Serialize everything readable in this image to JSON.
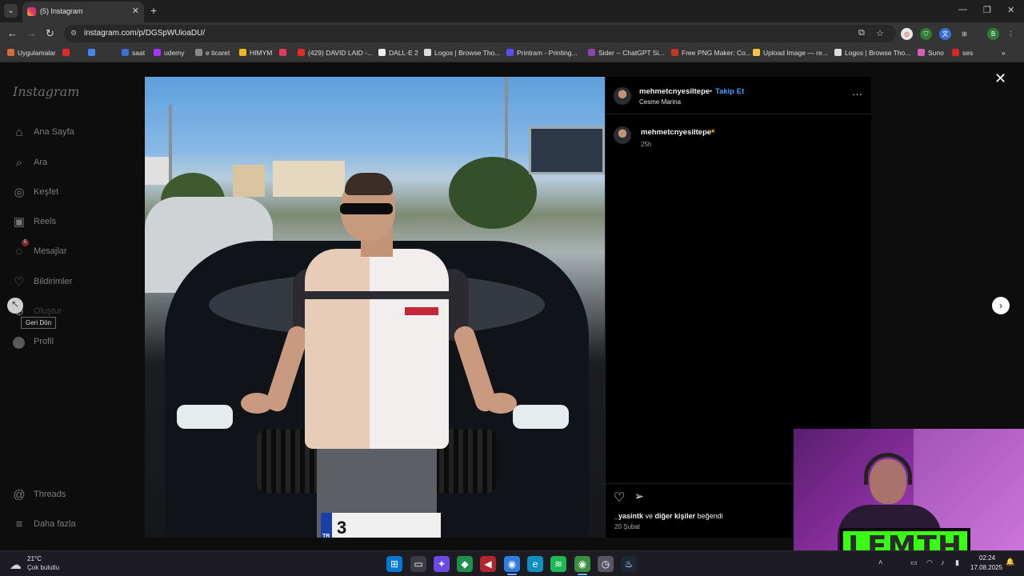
{
  "browser": {
    "tab_title": "(5) Instagram",
    "url": "instagram.com/p/DGSpWUioaDU/",
    "bookmarks": [
      {
        "label": "Uygulamalar",
        "color": "#d66a3a"
      },
      {
        "label": "",
        "color": "#e02b2b"
      },
      {
        "label": "",
        "color": "#4285f4"
      },
      {
        "label": "saat",
        "color": "#3b6fd6"
      },
      {
        "label": "udemy",
        "color": "#a435f0"
      },
      {
        "label": "e ticaret",
        "color": "#888888"
      },
      {
        "label": "HIMYM",
        "color": "#f0b429"
      },
      {
        "label": "",
        "color": "#e8365d"
      },
      {
        "label": "(429) DAVID LAID -...",
        "color": "#e02b2b"
      },
      {
        "label": "DALL·E 2",
        "color": "#eeeeee"
      },
      {
        "label": "Logos | Browse Tho...",
        "color": "#dddddd"
      },
      {
        "label": "Printram - Printing...",
        "color": "#5b4df0"
      },
      {
        "label": "Sider -- ChatGPT Si...",
        "color": "#8e44ad"
      },
      {
        "label": "Free PNG Maker: Co...",
        "color": "#c0392b"
      },
      {
        "label": "Upload Image — re...",
        "color": "#f5c542"
      },
      {
        "label": "Logos | Browse Tho...",
        "color": "#dddddd"
      },
      {
        "label": "Suno",
        "color": "#d65db1"
      },
      {
        "label": "ses",
        "color": "#d62828"
      }
    ]
  },
  "sidebar": {
    "logo": "Instagram",
    "items": [
      {
        "label": "Ana Sayfa",
        "icon": "home-icon",
        "glyph": "⌂"
      },
      {
        "label": "Ara",
        "icon": "search-icon",
        "glyph": "⌕"
      },
      {
        "label": "Keşfet",
        "icon": "compass-icon",
        "glyph": "◎"
      },
      {
        "label": "Reels",
        "icon": "reels-icon",
        "glyph": "▣"
      },
      {
        "label": "Mesajlar",
        "icon": "messenger-icon",
        "glyph": "◌"
      },
      {
        "label": "Bildirimler",
        "icon": "heart-icon",
        "glyph": "♡"
      },
      {
        "label": "Oluştur",
        "icon": "create-icon",
        "glyph": "⊕"
      },
      {
        "label": "Profil",
        "icon": "profile-avatar",
        "glyph": ""
      }
    ],
    "bottom_items": [
      {
        "label": "Threads",
        "icon": "threads-icon",
        "glyph": "@"
      },
      {
        "label": "Daha fazla",
        "icon": "menu-icon",
        "glyph": "≡"
      }
    ],
    "messages_badge": "5",
    "tooltip": "Geri Dön"
  },
  "post": {
    "username": "mehmetcnyesiltepe",
    "follow_label": "Takip Et",
    "separator": "•",
    "location": "Cesme Marina",
    "caption_emoji": "☀",
    "caption_time": "25h",
    "plate_text": "3",
    "plate_country": "TR",
    "likes_user": "_yasintk",
    "likes_conj": " ve ",
    "likes_others": "diğer kişiler",
    "likes_suffix": " beğendi",
    "date": "20 Şubat"
  },
  "webcam": {
    "overlay_text": "LEMTH"
  },
  "taskbar": {
    "temp": "21°C",
    "weather": "Çok bulutlu",
    "time": "02:24",
    "date": "17.08.2025",
    "apps": [
      {
        "name": "windows-start-icon",
        "glyph": "⊞",
        "color": "#0078d4"
      },
      {
        "name": "task-view-icon",
        "glyph": "▭",
        "color": "#3a3a44"
      },
      {
        "name": "copilot-icon",
        "glyph": "✦",
        "color": "#6a4ce0"
      },
      {
        "name": "app-green-icon",
        "glyph": "◆",
        "color": "#1f8f4e"
      },
      {
        "name": "app-red-icon",
        "glyph": "◀",
        "color": "#b3262b"
      },
      {
        "name": "chrome-icon",
        "glyph": "◉",
        "color": "#2f7de1"
      },
      {
        "name": "edge-icon",
        "glyph": "e",
        "color": "#0f8ec0"
      },
      {
        "name": "spotify-icon",
        "glyph": "≋",
        "color": "#1db954"
      },
      {
        "name": "chrome-profile-icon",
        "glyph": "◉",
        "color": "#3a8f3e"
      },
      {
        "name": "app-clock-icon",
        "glyph": "◷",
        "color": "#555566"
      },
      {
        "name": "steam-icon",
        "glyph": "♨",
        "color": "#1b2838"
      }
    ]
  }
}
